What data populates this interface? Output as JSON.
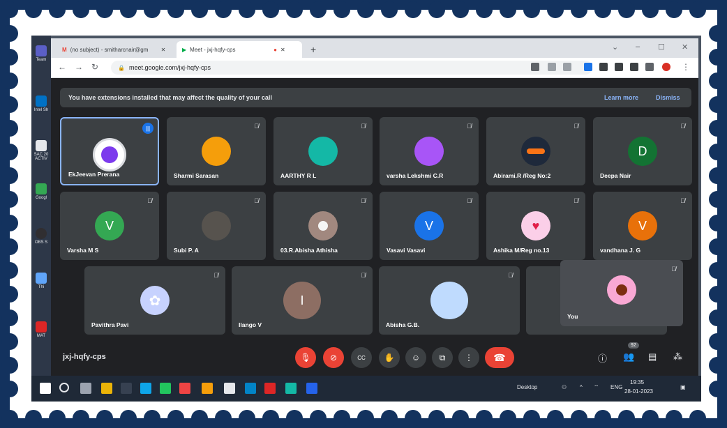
{
  "browser": {
    "tabs": [
      {
        "title": "(no subject) - smitharcnair@gm"
      },
      {
        "title": "Meet - jxj-hqfy-cps"
      }
    ],
    "url": "meet.google.com/jxj-hqfy-cps"
  },
  "banner": {
    "message": "You have extensions installed that may affect the quality of your call",
    "learn_more": "Learn more",
    "dismiss": "Dismiss"
  },
  "participants": {
    "row1": [
      "EkJeevan Prerana",
      "Sharmi Sarasan",
      "AARTHY R L",
      "varsha Lekshmi C.R",
      "Abirami.R /Reg No:2",
      "Deepa Nair"
    ],
    "row2": [
      "Varsha M S",
      "Subi P. A",
      "03.R.Abisha Athisha",
      "Vasavi Vasavi",
      "Ashika M/Reg no.13",
      "vandhana J. G"
    ],
    "row3": [
      "Pavithra Pavi",
      "Ilango V",
      "Abisha G.B."
    ],
    "self": "You",
    "initials": {
      "deepa": "D",
      "varsha": "V",
      "vasavi": "V",
      "vandhana": "V",
      "ilango": "I"
    }
  },
  "meeting": {
    "code": "jxj-hqfy-cps",
    "people_count": "92"
  },
  "taskbar": {
    "desktop_label": "Desktop",
    "lang": "ENG",
    "time": "19:35",
    "date": "28-01-2023"
  },
  "desktop_icons": [
    "Team",
    "Intel Sh",
    "SAC 20 ACTIV",
    "Googl",
    "OBS S",
    "Thi",
    "MAT"
  ],
  "colors": {
    "meet_bg": "#202124",
    "tile_bg": "#3c4043",
    "end_call": "#ea4335",
    "active_border": "#8ab4f8",
    "frame": "#13325e"
  }
}
